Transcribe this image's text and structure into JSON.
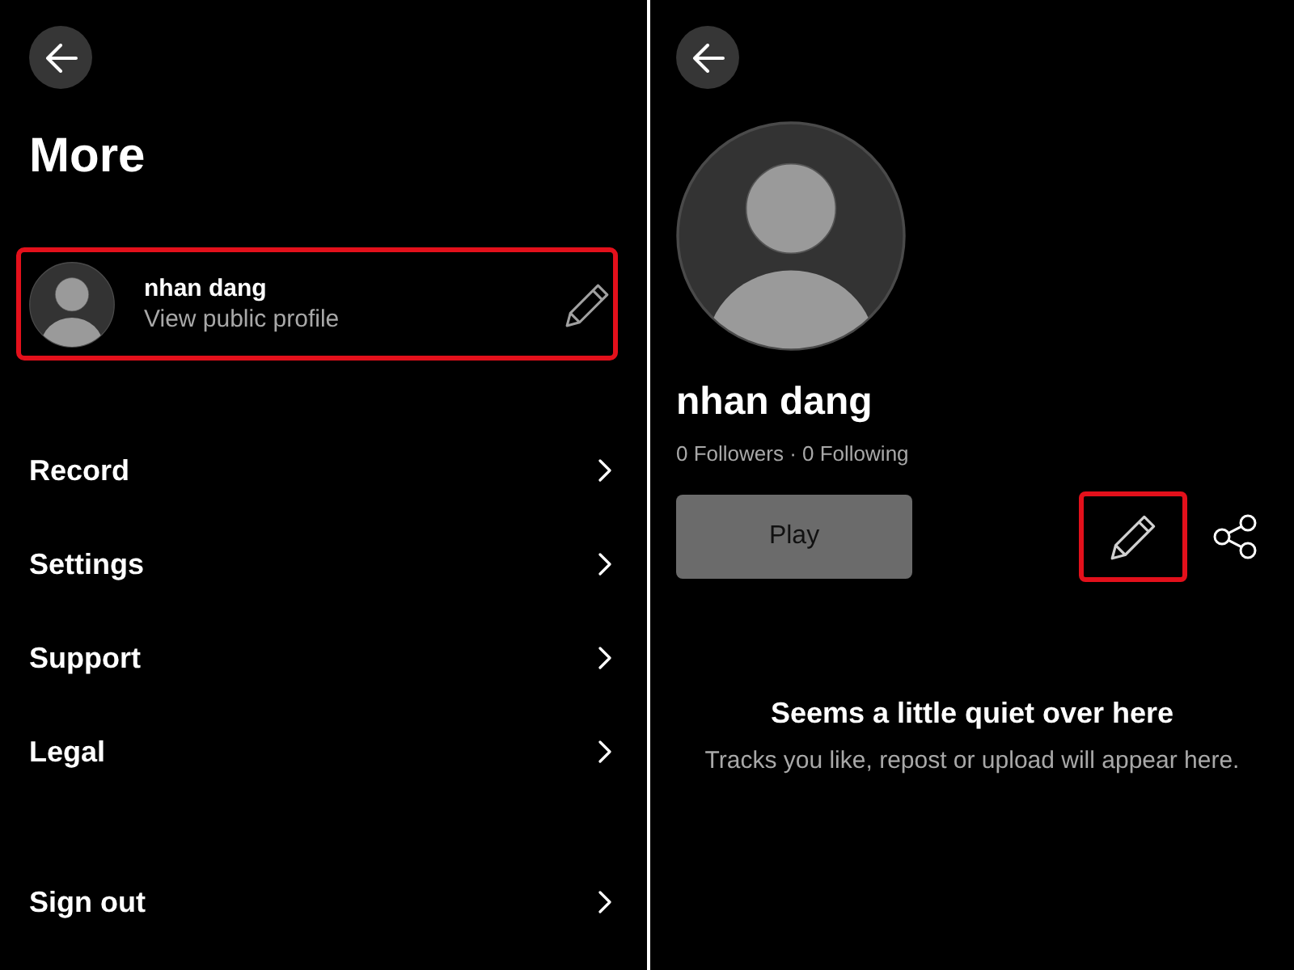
{
  "more_screen": {
    "title": "More",
    "profile": {
      "name": "nhan dang",
      "subtitle": "View public profile",
      "highlighted": true
    },
    "menu_groups": [
      {
        "items": [
          {
            "label": "Record"
          },
          {
            "label": "Settings"
          },
          {
            "label": "Support"
          },
          {
            "label": "Legal"
          }
        ]
      },
      {
        "items": [
          {
            "label": "Sign out"
          }
        ]
      }
    ]
  },
  "profile_screen": {
    "name": "nhan dang",
    "stats": "0 Followers · 0 Following",
    "play_button": "Play",
    "edit_button": {
      "highlighted": true
    },
    "empty_state": {
      "title": "Seems a little quiet over here",
      "message": "Tracks you like, repost or upload will appear here."
    }
  }
}
